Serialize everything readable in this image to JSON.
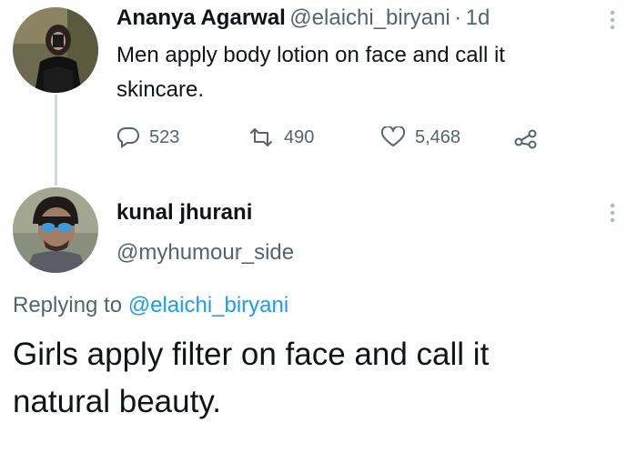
{
  "tweet1": {
    "name": "Ananya Agarwal",
    "handle": "@elaichi_biryani",
    "separator": "·",
    "time": "1d",
    "text_line1": "Men apply body lotion on face and call it",
    "text_line2": "skincare.",
    "replies": "523",
    "retweets": "490",
    "likes": "5,468",
    "icons": [
      "reply-icon",
      "retweet-icon",
      "like-icon",
      "share-icon",
      "more-icon"
    ]
  },
  "tweet2": {
    "name": "kunal jhurani",
    "handle": "@myhumour_side",
    "replying_label": "Replying to",
    "replying_handle": "@elaichi_biryani",
    "text_line1": "Girls apply filter on face and call it",
    "text_line2": "natural beauty.",
    "icons": [
      "more-icon"
    ]
  },
  "colors": {
    "text": "#0f1419",
    "secondary": "#536471",
    "link": "#1d9bf0",
    "thread_line": "#cfd9de"
  }
}
